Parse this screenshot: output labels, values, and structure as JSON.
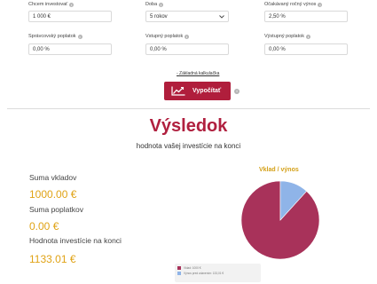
{
  "form": {
    "invest_label": "Chcem investovať",
    "invest_value": "1 000 €",
    "period_label": "Doba",
    "period_value": "5 rokov",
    "return_label": "Očakávaný ročný výnos",
    "return_value": "2,50 %",
    "mgmt_fee_label": "Správcovský poplatok",
    "mgmt_fee_value": "0,00 %",
    "entry_fee_label": "Vstupný poplatok",
    "entry_fee_value": "0,00 %",
    "exit_fee_label": "Výstupný poplatok",
    "exit_fee_value": "0,00 %"
  },
  "basic_calc_link": "- Základná kalkulačka",
  "calculate_button": "Vypočítať",
  "result": {
    "title": "Výsledok",
    "subtitle": "hodnota vašej investície na konci",
    "deposits_label": "Suma vkladov",
    "deposits_value": "1000.00 €",
    "fees_label": "Suma poplatkov",
    "fees_value": "0.00 €",
    "end_value_label": "Hodnota investície na konci",
    "end_value": "1133.01 €"
  },
  "chart_data": {
    "type": "pie",
    "title": "Vklad / výnos",
    "slices": [
      {
        "name": "Vklad: 1000 €",
        "value": 1000,
        "color": "#a8325a"
      },
      {
        "name": "Výnos pred zdanením: 133,01 €",
        "value": 133.01,
        "color": "#8fb4e8"
      }
    ]
  }
}
